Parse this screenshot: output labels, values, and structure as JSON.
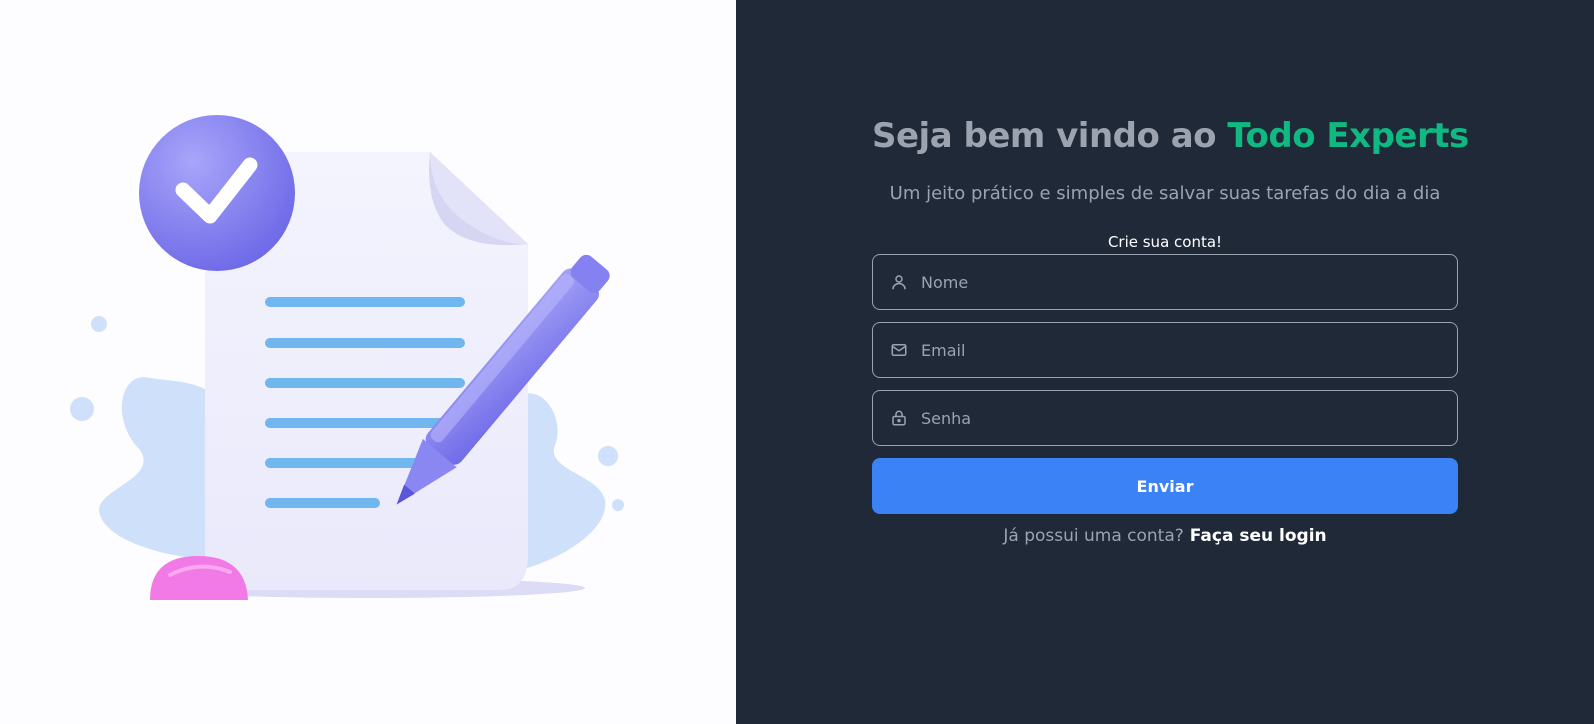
{
  "illustration": {
    "icon": "document-with-checkmark-and-pen-illustration"
  },
  "header": {
    "title_prefix": "Seja bem vindo ao",
    "brand": "Todo Experts",
    "subtitle": "Um jeito prático e simples de salvar suas tarefas do dia a dia"
  },
  "form": {
    "title": "Crie sua conta!",
    "name_placeholder": "Nome",
    "email_placeholder": "Email",
    "password_placeholder": "Senha",
    "submit_label": "Enviar"
  },
  "footer": {
    "question": "Já possui uma conta?",
    "login_link": "Faça seu login"
  },
  "colors": {
    "panel_bg": "#202938",
    "brand": "#10b981",
    "button": "#3b82f6",
    "muted_text": "#9ca3af"
  }
}
